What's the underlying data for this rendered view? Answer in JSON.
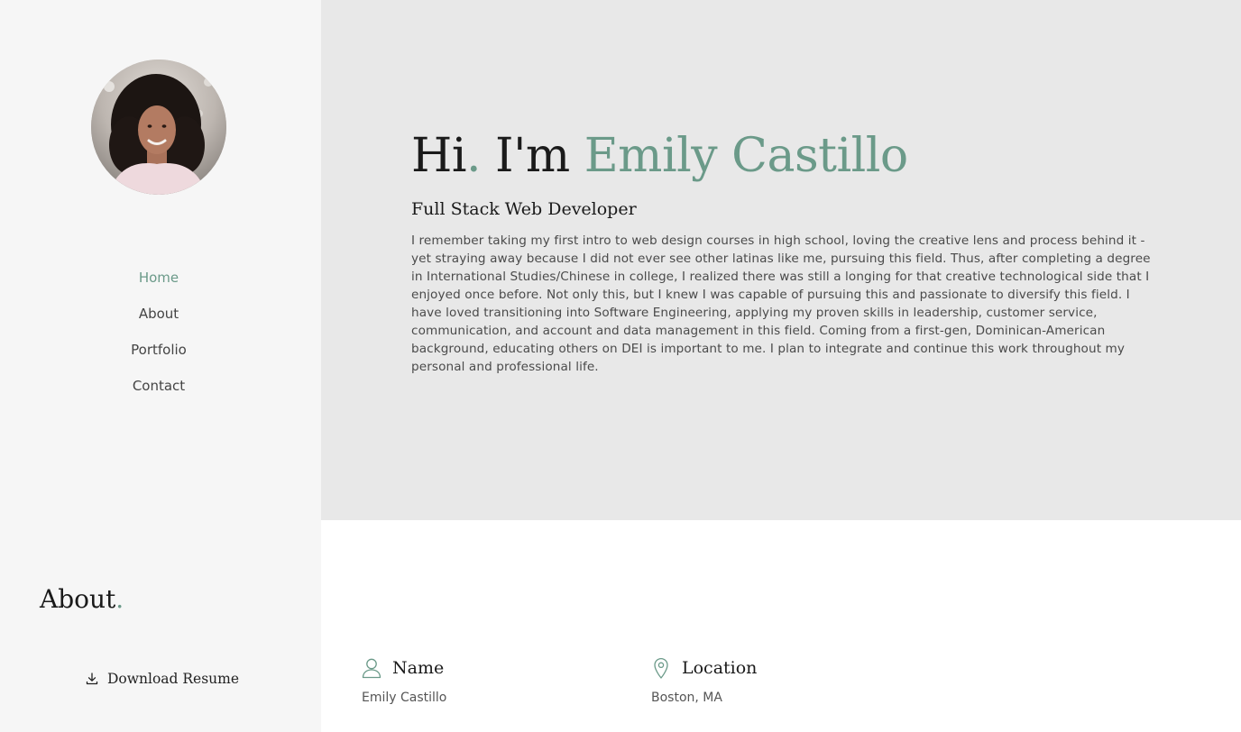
{
  "sidebar": {
    "avatar_alt": "Emily Castillo",
    "nav": [
      {
        "label": "Home",
        "active": true
      },
      {
        "label": "About",
        "active": false
      },
      {
        "label": "Portfolio",
        "active": false
      },
      {
        "label": "Contact",
        "active": false
      }
    ],
    "download_label": "Download Resume",
    "download_icon": "download-icon"
  },
  "hero": {
    "title_hi": "Hi",
    "title_dot": ".",
    "title_im": " I'm ",
    "title_name": "Emily Castillo",
    "subtitle": "Full Stack Web Developer",
    "bio": "I remember taking my first intro to web design courses in high school, loving the creative lens and process behind it - yet straying away because I did not ever see other latinas like me, pursuing this field. Thus, after completing a degree in International Studies/Chinese in college, I realized there was still a longing for that creative technological side that I enjoyed once before. Not only this, but I knew I was capable of pursuing this and passionate to diversify this field. I have loved transitioning into Software Engineering, applying my proven skills in leadership, customer service, communication, and account and data management in this field. Coming from a first-gen, Dominican-American background, educating others on DEI is important to me. I plan to integrate and continue this work throughout my personal and professional life."
  },
  "about": {
    "heading": "About",
    "heading_dot": ".",
    "name": {
      "label": "Name",
      "value": "Emily Castillo",
      "icon": "user-icon"
    },
    "location": {
      "label": "Location",
      "value": "Boston, MA",
      "icon": "map-pin-icon"
    }
  },
  "colors": {
    "accent": "#6b9a89",
    "sidebar_bg": "#f6f6f6",
    "hero_bg": "#e8e8e8"
  }
}
